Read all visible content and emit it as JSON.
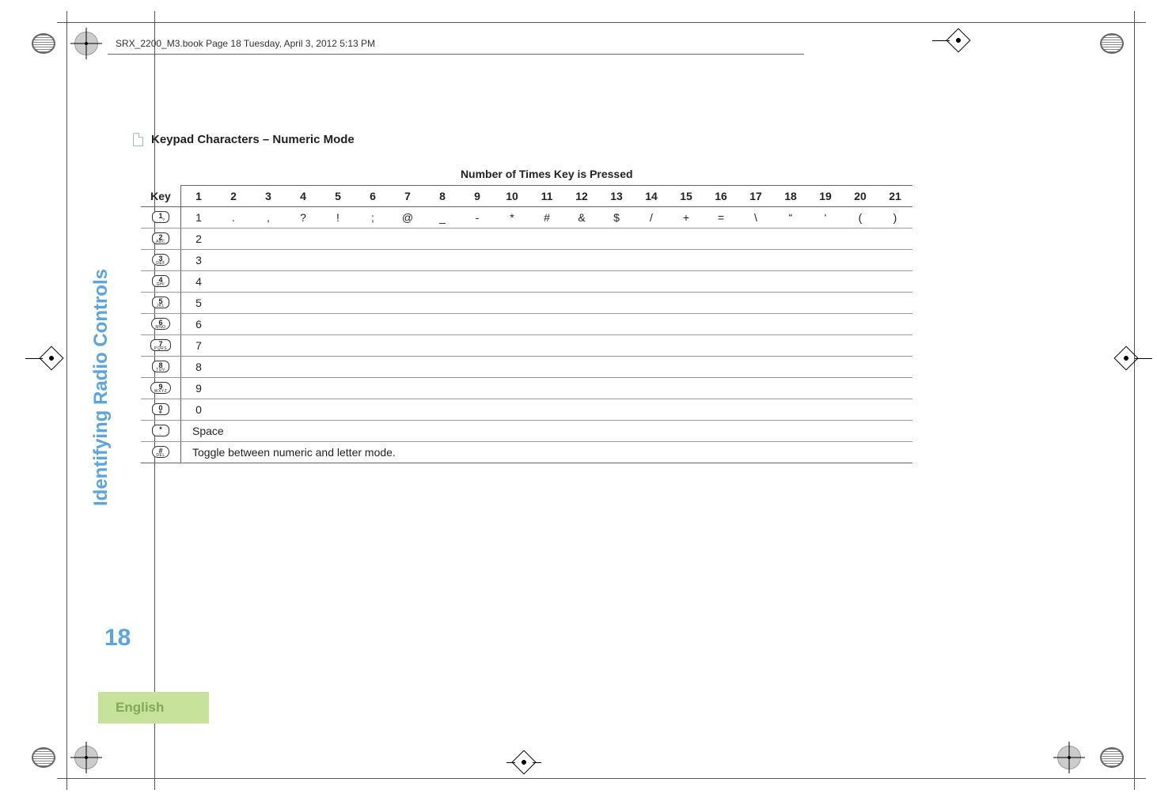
{
  "book_header": "SRX_2200_M3.book  Page 18  Tuesday, April 3, 2012  5:13 PM",
  "sidebar_title": "Identifying Radio Controls",
  "page_number": "18",
  "language": "English",
  "heading": "Keypad Characters – Numeric Mode",
  "table": {
    "super_header": "Number of Times Key is Pressed",
    "key_label": "Key",
    "columns": [
      "1",
      "2",
      "3",
      "4",
      "5",
      "6",
      "7",
      "8",
      "9",
      "10",
      "11",
      "12",
      "13",
      "14",
      "15",
      "16",
      "17",
      "18",
      "19",
      "20",
      "21"
    ],
    "rows": [
      {
        "keycap": {
          "main": "1",
          "sub": ". , ?"
        },
        "cells": [
          "1",
          ".",
          ",",
          "?",
          "!",
          ";",
          "@",
          "_",
          "-",
          "*",
          "#",
          "&",
          "$",
          "/",
          "+",
          "=",
          "\\",
          "“",
          "‘",
          "(",
          ")"
        ]
      },
      {
        "keycap": {
          "main": "2",
          "sub": "ABC"
        },
        "cells": [
          "2"
        ]
      },
      {
        "keycap": {
          "main": "3",
          "sub": "DEF",
          "round": true
        },
        "cells": [
          "3"
        ]
      },
      {
        "keycap": {
          "main": "4",
          "sub": "GHI"
        },
        "cells": [
          "4"
        ]
      },
      {
        "keycap": {
          "main": "5",
          "sub": "JKL"
        },
        "cells": [
          "5"
        ]
      },
      {
        "keycap": {
          "main": "6",
          "sub": "MNO",
          "round": true
        },
        "cells": [
          "6"
        ]
      },
      {
        "keycap": {
          "main": "7",
          "sub": "PQRS"
        },
        "cells": [
          "7"
        ]
      },
      {
        "keycap": {
          "main": "8",
          "sub": "TUV"
        },
        "cells": [
          "8"
        ]
      },
      {
        "keycap": {
          "main": "9",
          "sub": "WXYZ",
          "round": true
        },
        "cells": [
          "9"
        ]
      },
      {
        "keycap": {
          "main": "0",
          "sub": "❖"
        },
        "cells": [
          "0"
        ]
      },
      {
        "keycap": {
          "main": "*",
          "sub": "←"
        },
        "span_text": "Space"
      },
      {
        "keycap": {
          "main": "#",
          "sub": "DEL",
          "round": true
        },
        "span_text": "Toggle between numeric and letter mode."
      }
    ]
  }
}
